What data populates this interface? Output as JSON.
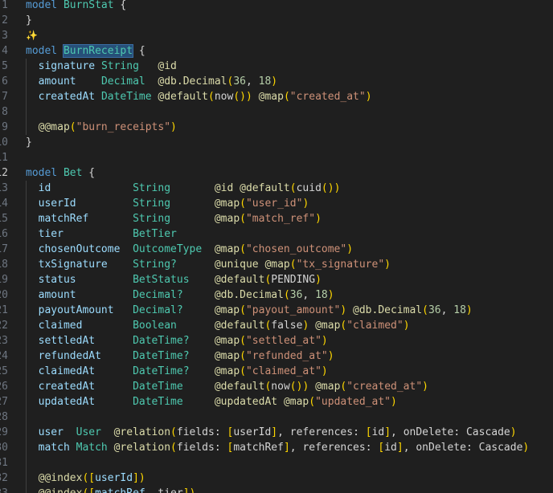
{
  "editor": {
    "start_line": 1,
    "current_line": 12,
    "highlight_word": "BurnReceipt",
    "ai_hint_icon": "sparkle-icon",
    "lines": [
      "model BurnStat {",
      "}",
      "",
      "model BurnReceipt {",
      "  signature String   @id",
      "  amount    Decimal  @db.Decimal(36, 18)",
      "  createdAt DateTime @default(now()) @map(\"created_at\")",
      "",
      "  @@map(\"burn_receipts\")",
      "}",
      "",
      "model Bet {",
      "  id             String       @id @default(cuid())",
      "  userId         String       @map(\"user_id\")",
      "  matchRef       String       @map(\"match_ref\")",
      "  tier           BetTier",
      "  chosenOutcome  OutcomeType  @map(\"chosen_outcome\")",
      "  txSignature    String?      @unique @map(\"tx_signature\")",
      "  status         BetStatus    @default(PENDING)",
      "  amount         Decimal?     @db.Decimal(36, 18)",
      "  payoutAmount   Decimal?     @map(\"payout_amount\") @db.Decimal(36, 18)",
      "  claimed        Boolean      @default(false) @map(\"claimed\")",
      "  settledAt      DateTime?    @map(\"settled_at\")",
      "  refundedAt     DateTime?    @map(\"refunded_at\")",
      "  claimedAt      DateTime?    @map(\"claimed_at\")",
      "  createdAt      DateTime     @default(now()) @map(\"created_at\")",
      "  updatedAt      DateTime     @updatedAt @map(\"updated_at\")",
      "",
      "  user  User  @relation(fields: [userId], references: [id], onDelete: Cascade)",
      "  match Match @relation(fields: [matchRef], references: [id], onDelete: Cascade)",
      "",
      "  @@index([userId])",
      "  @@index([matchRef, tier])"
    ]
  },
  "colors": {
    "keyword": "#569cd6",
    "type": "#4ec9b0",
    "identifier": "#9cdcfe",
    "string": "#ce9178",
    "attribute": "#dcdcaa",
    "number": "#b5cea8",
    "bracket": "#ffd700",
    "text": "#d4d4d4"
  }
}
